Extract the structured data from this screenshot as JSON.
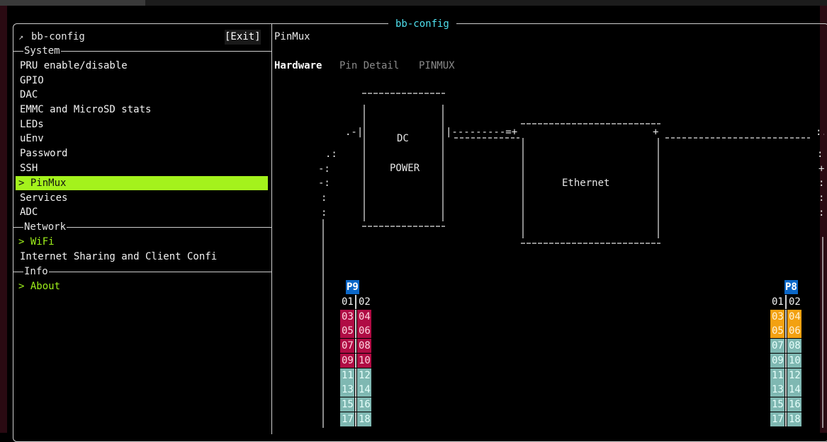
{
  "window": {
    "title": "bb-config"
  },
  "sidebar": {
    "app_name": "bb-config",
    "exit_label": "[Exit]",
    "sections": [
      {
        "label": "System",
        "items": [
          "PRU enable/disable",
          "GPIO",
          "DAC",
          "EMMC and MicroSD stats",
          "LEDs",
          "uEnv",
          "Password",
          "SSH",
          "> PinMux",
          "Services",
          "ADC"
        ]
      },
      {
        "label": "Network",
        "items": [
          "> WiFi",
          "Internet Sharing and Client Confi"
        ]
      },
      {
        "label": "Info",
        "items": [
          "> About"
        ]
      }
    ]
  },
  "main": {
    "title": "PinMux",
    "tabs": [
      "Hardware",
      "Pin Detail",
      "PINMUX"
    ],
    "diagram": {
      "dc_label_1": "DC",
      "dc_label_2": "POWER",
      "ethernet_label": "Ethernet"
    },
    "headers": {
      "p9": {
        "label": "P9",
        "rows": [
          [
            "01",
            "02"
          ],
          [
            "03",
            "04"
          ],
          [
            "05",
            "06"
          ],
          [
            "07",
            "08"
          ],
          [
            "09",
            "10"
          ],
          [
            "11",
            "12"
          ],
          [
            "13",
            "14"
          ],
          [
            "15",
            "16"
          ],
          [
            "17",
            "18"
          ]
        ]
      },
      "p8": {
        "label": "P8",
        "rows": [
          [
            "01",
            "02"
          ],
          [
            "03",
            "04"
          ],
          [
            "05",
            "06"
          ],
          [
            "07",
            "08"
          ],
          [
            "09",
            "10"
          ],
          [
            "11",
            "12"
          ],
          [
            "13",
            "14"
          ],
          [
            "15",
            "16"
          ],
          [
            "17",
            "18"
          ]
        ]
      }
    }
  },
  "colors": {
    "title": "#4fe0ee",
    "selected": "#a4f21c",
    "green_text": "#9ef01a",
    "pin_red": "#b00c44",
    "pin_teal": "#7fb8b2",
    "pin_orange": "#f3a111",
    "header_tag": "#0b67c8"
  }
}
